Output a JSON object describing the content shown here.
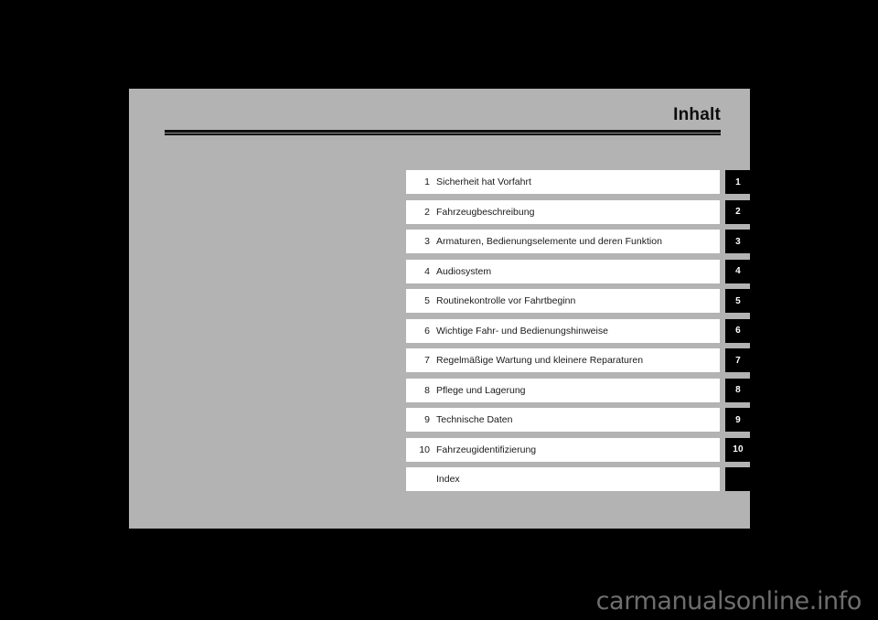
{
  "document": {
    "title": "Inhalt",
    "background_color": "#000000",
    "page_color": "#b3b3b3",
    "tab_color": "#000000",
    "row_color": "#ffffff"
  },
  "toc": {
    "entries": [
      {
        "number": "1",
        "label": "Sicherheit hat Vorfahrt",
        "tab": "1"
      },
      {
        "number": "2",
        "label": "Fahrzeugbeschreibung",
        "tab": "2"
      },
      {
        "number": "3",
        "label": "Armaturen, Bedienungselemente und deren Funktion",
        "tab": "3"
      },
      {
        "number": "4",
        "label": "Audiosystem",
        "tab": "4"
      },
      {
        "number": "5",
        "label": "Routinekontrolle vor Fahrtbeginn",
        "tab": "5"
      },
      {
        "number": "6",
        "label": "Wichtige Fahr- und Bedienungshinweise",
        "tab": "6"
      },
      {
        "number": "7",
        "label": "Regelmäßige Wartung und kleinere Reparaturen",
        "tab": "7"
      },
      {
        "number": "8",
        "label": "Pflege und Lagerung",
        "tab": "8"
      },
      {
        "number": "9",
        "label": "Technische Daten",
        "tab": "9"
      },
      {
        "number": "10",
        "label": "Fahrzeugidentifizierung",
        "tab": "10"
      },
      {
        "number": "",
        "label": "Index",
        "tab": ""
      }
    ]
  },
  "watermark": {
    "text": "carmanualsonline.info"
  }
}
